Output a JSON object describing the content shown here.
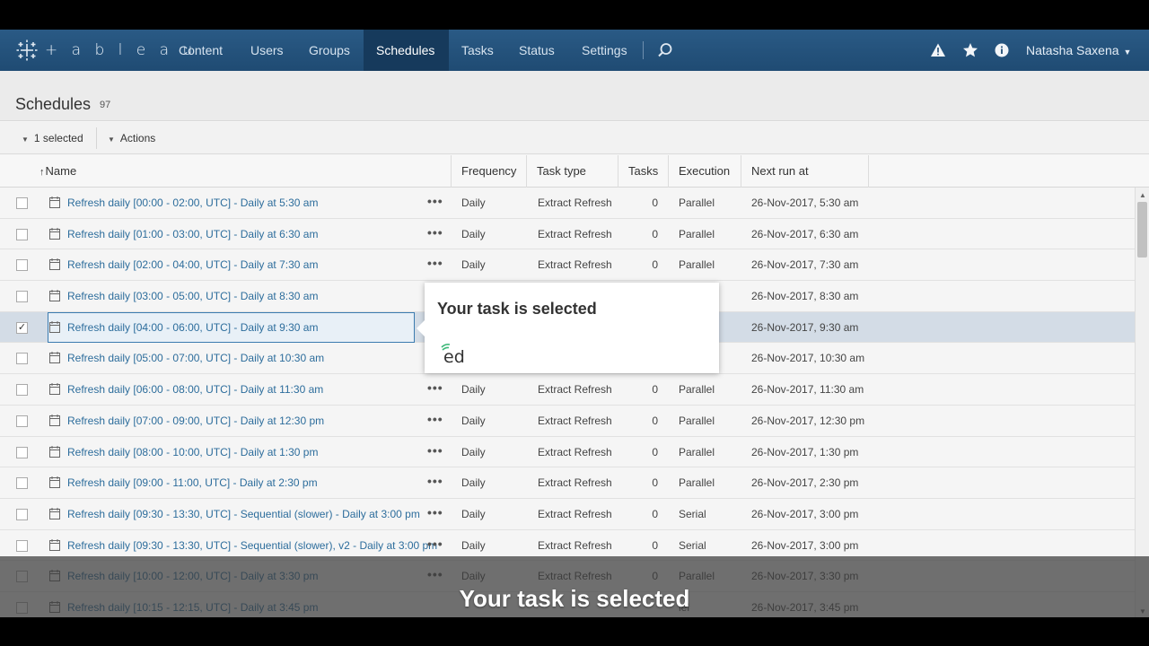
{
  "app": {
    "logo_text": "+ a b l e a u"
  },
  "nav": {
    "items": [
      {
        "label": "Content",
        "active": false
      },
      {
        "label": "Users",
        "active": false
      },
      {
        "label": "Groups",
        "active": false
      },
      {
        "label": "Schedules",
        "active": true
      },
      {
        "label": "Tasks",
        "active": false
      },
      {
        "label": "Status",
        "active": false
      },
      {
        "label": "Settings",
        "active": false
      }
    ],
    "user_name": "Natasha Saxena"
  },
  "page": {
    "title": "Schedules",
    "count": "97"
  },
  "toolbar": {
    "selected_label": "1 selected",
    "actions_label": "Actions"
  },
  "table": {
    "headers": {
      "name": "Name",
      "frequency": "Frequency",
      "task_type": "Task type",
      "tasks": "Tasks",
      "execution": "Execution",
      "next_run": "Next run at"
    },
    "rows": [
      {
        "name": "Refresh daily [00:00 - 02:00, UTC] - Daily at 5:30 am",
        "frequency": "Daily",
        "task_type": "Extract Refresh",
        "tasks": "0",
        "execution": "Parallel",
        "next_run": "26-Nov-2017, 5:30 am",
        "checked": false
      },
      {
        "name": "Refresh daily [01:00 - 03:00, UTC] - Daily at 6:30 am",
        "frequency": "Daily",
        "task_type": "Extract Refresh",
        "tasks": "0",
        "execution": "Parallel",
        "next_run": "26-Nov-2017, 6:30 am",
        "checked": false
      },
      {
        "name": "Refresh daily [02:00 - 04:00, UTC] - Daily at 7:30 am",
        "frequency": "Daily",
        "task_type": "Extract Refresh",
        "tasks": "0",
        "execution": "Parallel",
        "next_run": "26-Nov-2017, 7:30 am",
        "checked": false
      },
      {
        "name": "Refresh daily [03:00 - 05:00, UTC] - Daily at 8:30 am",
        "frequency": "",
        "task_type": "",
        "tasks": "",
        "execution": "",
        "next_run": "26-Nov-2017, 8:30 am",
        "checked": false
      },
      {
        "name": "Refresh daily [04:00 - 06:00, UTC] - Daily at 9:30 am",
        "frequency": "",
        "task_type": "",
        "tasks": "",
        "execution": "",
        "next_run": "26-Nov-2017, 9:30 am",
        "checked": true
      },
      {
        "name": "Refresh daily [05:00 - 07:00, UTC] - Daily at 10:30 am",
        "frequency": "",
        "task_type": "",
        "tasks": "",
        "execution": "",
        "next_run": "26-Nov-2017, 10:30 am",
        "checked": false
      },
      {
        "name": "Refresh daily [06:00 - 08:00, UTC] - Daily at 11:30 am",
        "frequency": "Daily",
        "task_type": "Extract Refresh",
        "tasks": "0",
        "execution": "Parallel",
        "next_run": "26-Nov-2017, 11:30 am",
        "checked": false
      },
      {
        "name": "Refresh daily [07:00 - 09:00, UTC] - Daily at 12:30 pm",
        "frequency": "Daily",
        "task_type": "Extract Refresh",
        "tasks": "0",
        "execution": "Parallel",
        "next_run": "26-Nov-2017, 12:30 pm",
        "checked": false
      },
      {
        "name": "Refresh daily [08:00 - 10:00, UTC] - Daily at 1:30 pm",
        "frequency": "Daily",
        "task_type": "Extract Refresh",
        "tasks": "0",
        "execution": "Parallel",
        "next_run": "26-Nov-2017, 1:30 pm",
        "checked": false
      },
      {
        "name": "Refresh daily [09:00 - 11:00, UTC] - Daily at 2:30 pm",
        "frequency": "Daily",
        "task_type": "Extract Refresh",
        "tasks": "0",
        "execution": "Parallel",
        "next_run": "26-Nov-2017, 2:30 pm",
        "checked": false
      },
      {
        "name": "Refresh daily [09:30 - 13:30, UTC] - Sequential (slower) - Daily at 3:00 pm",
        "frequency": "Daily",
        "task_type": "Extract Refresh",
        "tasks": "0",
        "execution": "Serial",
        "next_run": "26-Nov-2017, 3:00 pm",
        "checked": false
      },
      {
        "name": "Refresh daily [09:30 - 13:30, UTC] - Sequential (slower), v2 - Daily at 3:00 pm",
        "frequency": "Daily",
        "task_type": "Extract Refresh",
        "tasks": "0",
        "execution": "Serial",
        "next_run": "26-Nov-2017, 3:00 pm",
        "checked": false
      },
      {
        "name": "Refresh daily [10:00 - 12:00, UTC] - Daily at 3:30 pm",
        "frequency": "Daily",
        "task_type": "Extract Refresh",
        "tasks": "0",
        "execution": "Parallel",
        "next_run": "26-Nov-2017, 3:30 pm",
        "checked": false
      },
      {
        "name": "Refresh daily [10:15 - 12:15, UTC] - Daily at 3:45 pm",
        "frequency": "",
        "task_type": "",
        "tasks": "",
        "execution": "lel",
        "next_run": "26-Nov-2017, 3:45 pm",
        "checked": false
      }
    ]
  },
  "popup": {
    "title": "Your task is selected",
    "logo_text": "ed"
  },
  "caption": "Your task is selected",
  "colors": {
    "nav_bg": "#1f4b73",
    "nav_active": "#163a5c",
    "link": "#2d6d9c",
    "selected_row": "#d3dce6"
  }
}
